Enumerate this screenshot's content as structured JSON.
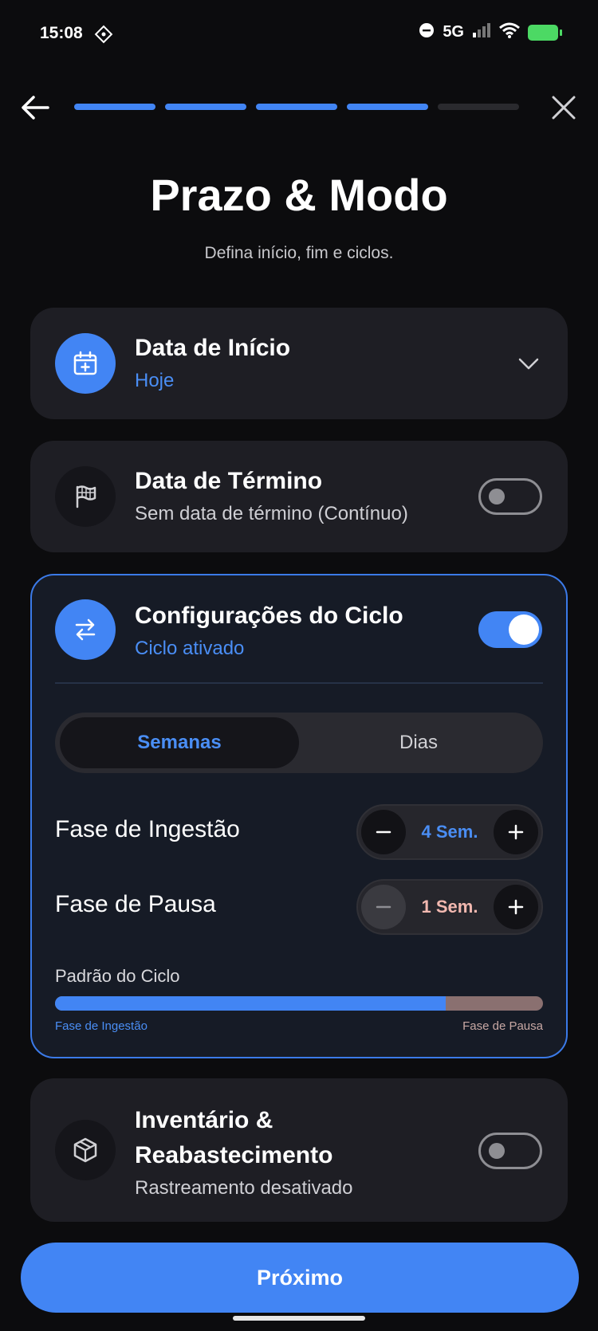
{
  "status": {
    "time": "15:08",
    "network": "5G"
  },
  "progress": {
    "steps_total": 5,
    "steps_done": 4
  },
  "header": {
    "title": "Prazo & Modo",
    "subtitle": "Defina início, fim e ciclos."
  },
  "start_card": {
    "title": "Data de Início",
    "value": "Hoje"
  },
  "end_card": {
    "title": "Data de Término",
    "value": "Sem data de término (Contínuo)",
    "enabled": false
  },
  "cycle_card": {
    "title": "Configurações do Ciclo",
    "status": "Ciclo ativado",
    "enabled": true,
    "units": [
      "Semanas",
      "Dias"
    ],
    "selected_unit": "Semanas",
    "intake": {
      "label": "Fase de Ingestão",
      "value": "4 Sem."
    },
    "pause": {
      "label": "Fase de Pausa",
      "value": "1 Sem."
    },
    "pattern_label": "Padrão do Ciclo",
    "pattern_intake_label": "Fase de Ingestão",
    "pattern_pause_label": "Fase de Pausa",
    "pattern_intake_fraction": 0.8
  },
  "inventory_card": {
    "title_line1": "Inventário &",
    "title_line2": "Reabastecimento",
    "status": "Rastreamento desativado",
    "enabled": false
  },
  "footer": {
    "next_label": "Próximo"
  },
  "colors": {
    "accent": "#4285f4",
    "pause": "#8a7070",
    "pause_text": "#f2b8b0"
  }
}
